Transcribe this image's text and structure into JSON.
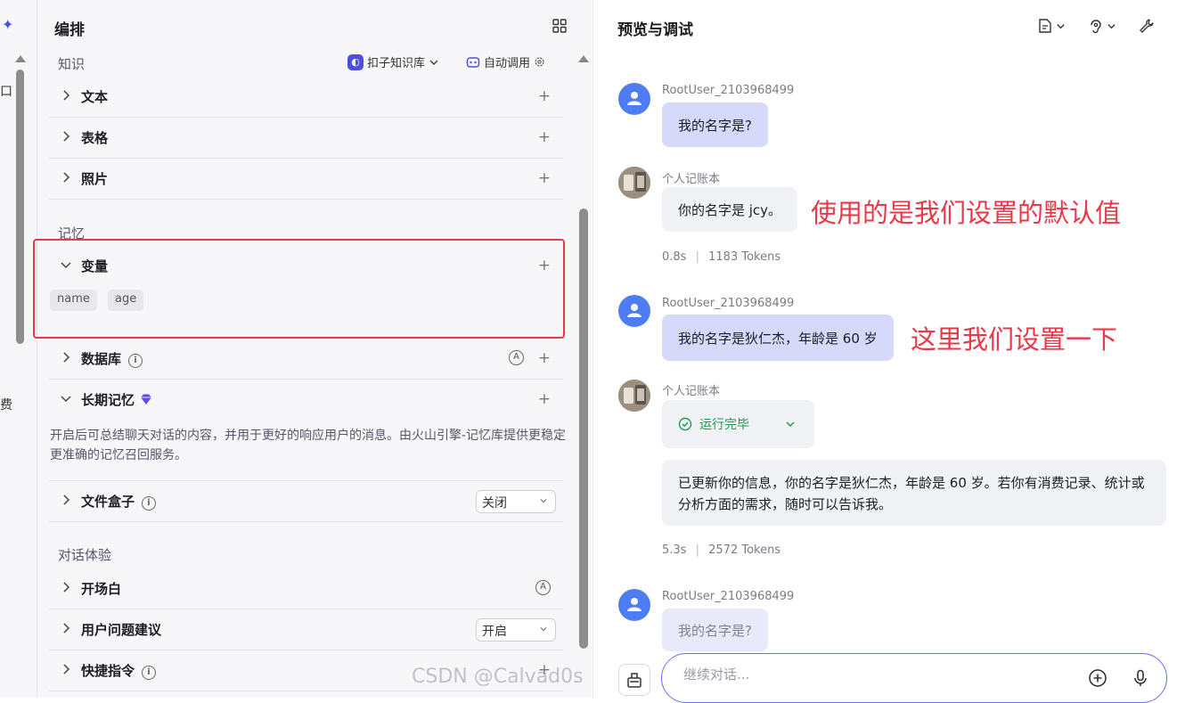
{
  "left_strip": {
    "frag_top": "口",
    "frag_bottom": "费"
  },
  "config": {
    "title": "编排",
    "knowledge": {
      "label": "知识",
      "kb_selector": "扣子知识库",
      "auto_call": "自动调用",
      "items": [
        "文本",
        "表格",
        "照片"
      ]
    },
    "memory": {
      "label": "记忆",
      "variables": {
        "label": "变量",
        "chips": [
          "name",
          "age"
        ]
      },
      "database": {
        "label": "数据库"
      },
      "long_term": {
        "label": "长期记忆",
        "description": "开启后可总结聊天对话的内容，并用于更好的响应用户的消息。由火山引擎-记忆库提供更稳定更准确的记忆召回服务。"
      },
      "filebox": {
        "label": "文件盒子",
        "value": "关闭"
      }
    },
    "dialog": {
      "label": "对话体验",
      "opening": {
        "label": "开场白"
      },
      "suggestions": {
        "label": "用户问题建议",
        "value": "开启"
      },
      "shortcuts": {
        "label": "快捷指令"
      }
    }
  },
  "preview": {
    "title": "预览与调试",
    "messages": {
      "u1": {
        "sender": "RootUser_2103968499",
        "text": "我的名字是?"
      },
      "b1": {
        "sender": "个人记账本",
        "text": "你的名字是 jcy。",
        "time": "0.8s",
        "tokens": "1183 Tokens"
      },
      "u2": {
        "sender": "RootUser_2103968499",
        "text": "我的名字是狄仁杰，年龄是 60 岁"
      },
      "b2": {
        "sender": "个人记账本",
        "status": "运行完毕",
        "text": "已更新你的信息，你的名字是狄仁杰，年龄是 60 岁。若你有消费记录、统计或分析方面的需求，随时可以告诉我。",
        "time": "5.3s",
        "tokens": "2572 Tokens"
      },
      "u3": {
        "sender": "RootUser_2103968499",
        "text": "我的名字是?"
      }
    },
    "annotations": {
      "a1": "使用的是我们设置的默认值",
      "a2": "这里我们设置一下"
    },
    "input": {
      "placeholder": "继续对话..."
    }
  },
  "watermark": "CSDN @Calvad0s",
  "colors": {
    "accent": "#4b4fe0",
    "highlight": "#e8394b",
    "user_bubble": "#d7d9fb",
    "bot_bubble": "#f1f2f6",
    "success": "#1e9a4c"
  }
}
